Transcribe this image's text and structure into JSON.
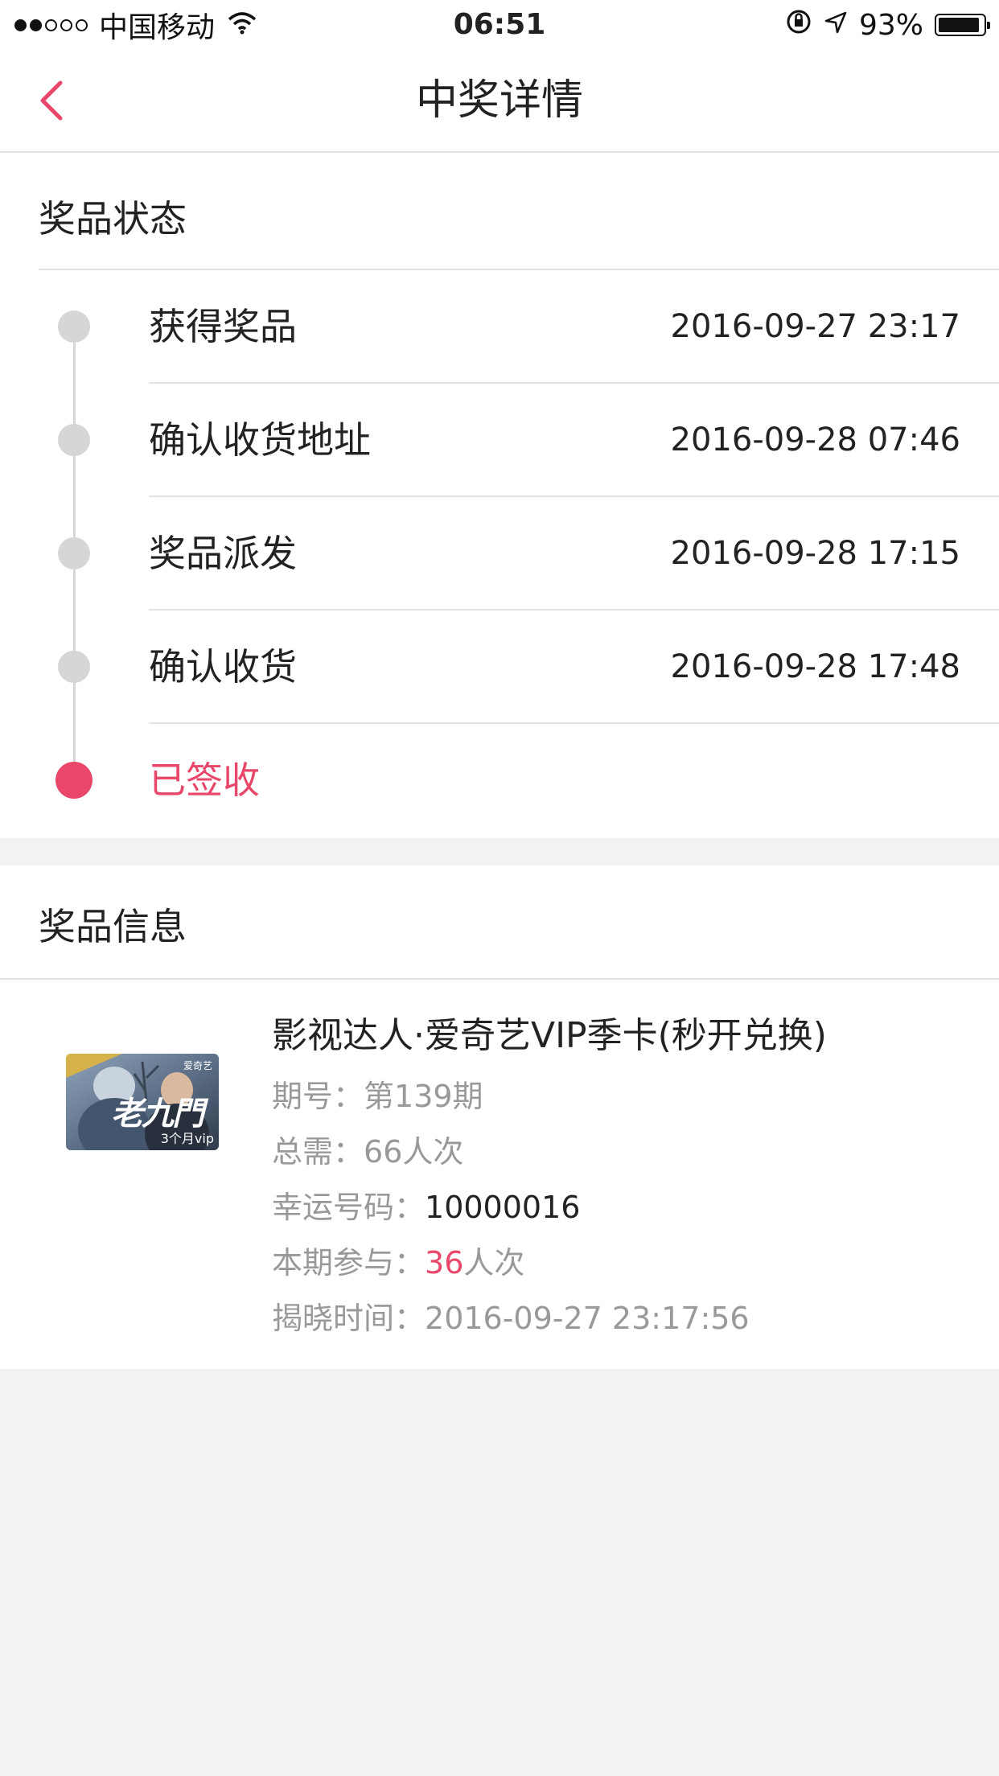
{
  "status_bar": {
    "carrier": "中国移动",
    "time": "06:51",
    "battery": "93%",
    "battery_level": 0.93
  },
  "nav": {
    "title": "中奖详情",
    "back_icon": "chevron-left-icon"
  },
  "status_section": {
    "title": "奖品状态",
    "steps": [
      {
        "label": "获得奖品",
        "time": "2016-09-27 23:17"
      },
      {
        "label": "确认收货地址",
        "time": "2016-09-28 07:46"
      },
      {
        "label": "奖品派发",
        "time": "2016-09-28 17:15"
      },
      {
        "label": "确认收货",
        "time": "2016-09-28 17:48"
      },
      {
        "label": "已签收",
        "time": ""
      }
    ]
  },
  "info_section": {
    "title": "奖品信息",
    "thumbnail": {
      "logo_text": "老九門",
      "badge": "3个月vip",
      "brand": "爱奇艺"
    },
    "prize_name": "影视达人·爱奇艺VIP季卡(秒开兑换)",
    "issue_label": "期号：",
    "issue_value": "第139期",
    "total_label": "总需：",
    "total_value": "66人次",
    "lucky_label": "幸运号码：",
    "lucky_value": "10000016",
    "participate_label": "本期参与：",
    "participate_count": "36",
    "participate_unit": "人次",
    "reveal_label": "揭晓时间：",
    "reveal_value": "2016-09-27 23:17:56"
  },
  "colors": {
    "accent": "#e8476a",
    "inactive_dot": "#d6d6d6",
    "background": "#f2f2f2"
  }
}
